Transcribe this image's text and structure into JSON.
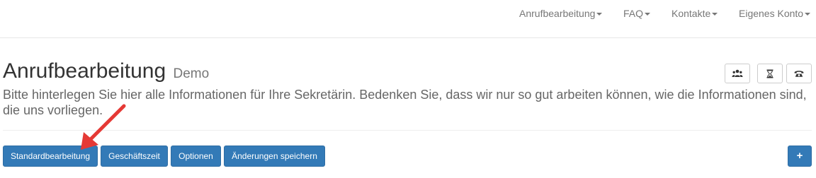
{
  "nav": {
    "items": [
      {
        "label": "Anrufbearbeitung"
      },
      {
        "label": "FAQ"
      },
      {
        "label": "Kontakte"
      },
      {
        "label": "Eigenes Konto"
      }
    ]
  },
  "header": {
    "title": "Anrufbearbeitung",
    "subtitle": "Demo"
  },
  "header_icons": [
    "users-icon",
    "hourglass-icon",
    "phone-icon"
  ],
  "intro_text": "Bitte hinterlegen Sie hier alle Informationen für Ihre Sekretärin. Bedenken Sie, dass wir nur so gut arbeiten können, wie die Informationen sind, die uns vorliegen.",
  "tabs": [
    {
      "label": "Standardbearbeitung"
    },
    {
      "label": "Geschäftszeit"
    },
    {
      "label": "Optionen"
    },
    {
      "label": "Änderungen speichern"
    }
  ],
  "add_button": {
    "label": "+"
  },
  "colors": {
    "primary": "#337ab7",
    "annotation_arrow": "#e53935",
    "nav_text": "#777777"
  }
}
